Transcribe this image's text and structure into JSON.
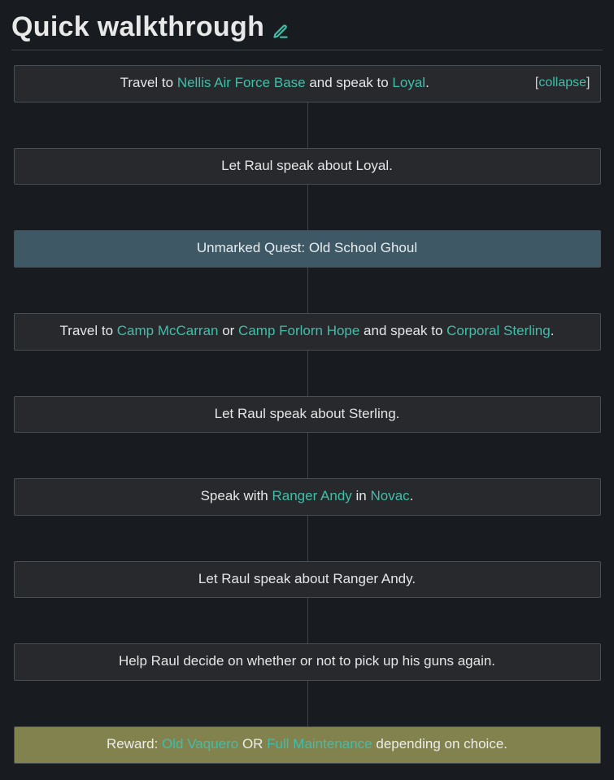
{
  "section": {
    "title": "Quick walkthrough"
  },
  "collapse_label": "collapse",
  "steps": {
    "s1": {
      "t1": "Travel to ",
      "l1": "Nellis Air Force Base",
      "t2": " and speak to ",
      "l2": "Loyal",
      "t3": "."
    },
    "s2": {
      "text": "Let Raul speak about Loyal."
    },
    "s3": {
      "text": "Unmarked Quest: Old School Ghoul"
    },
    "s4": {
      "t1": "Travel to ",
      "l1": "Camp McCarran",
      "t2": " or ",
      "l2": "Camp Forlorn Hope",
      "t3": " and speak to ",
      "l3": "Corporal Sterling",
      "t4": "."
    },
    "s5": {
      "text": "Let Raul speak about Sterling."
    },
    "s6": {
      "t1": "Speak with ",
      "l1": "Ranger Andy",
      "t2": " in ",
      "l2": "Novac",
      "t3": "."
    },
    "s7": {
      "text": "Let Raul speak about Ranger Andy."
    },
    "s8": {
      "text": "Help Raul decide on whether or not to pick up his guns again."
    },
    "s9": {
      "t1": "Reward: ",
      "l1": "Old Vaquero",
      "t2": " OR ",
      "l2": "Full Maintenance",
      "t3": " depending on choice."
    }
  }
}
